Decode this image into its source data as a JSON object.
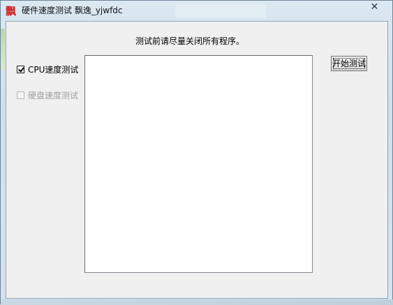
{
  "window": {
    "title": "硬件速度测试 飘逸_yjwfdc",
    "icon_glyph": "飘",
    "icon": "app-logo-icon",
    "close_glyph": "✕"
  },
  "main": {
    "prompt_text": "测试前请尽量关闭所有程序。",
    "output_text": ""
  },
  "options": {
    "cpu_label": "CPU速度测试",
    "cpu_checked": true,
    "disk_label": "硬盘速度测试",
    "disk_checked": false,
    "disk_enabled": false
  },
  "buttons": {
    "start_label": "开始测试"
  },
  "colors": {
    "icon_red": "#cc1f1f",
    "disabled_text": "#a0a0a0"
  }
}
